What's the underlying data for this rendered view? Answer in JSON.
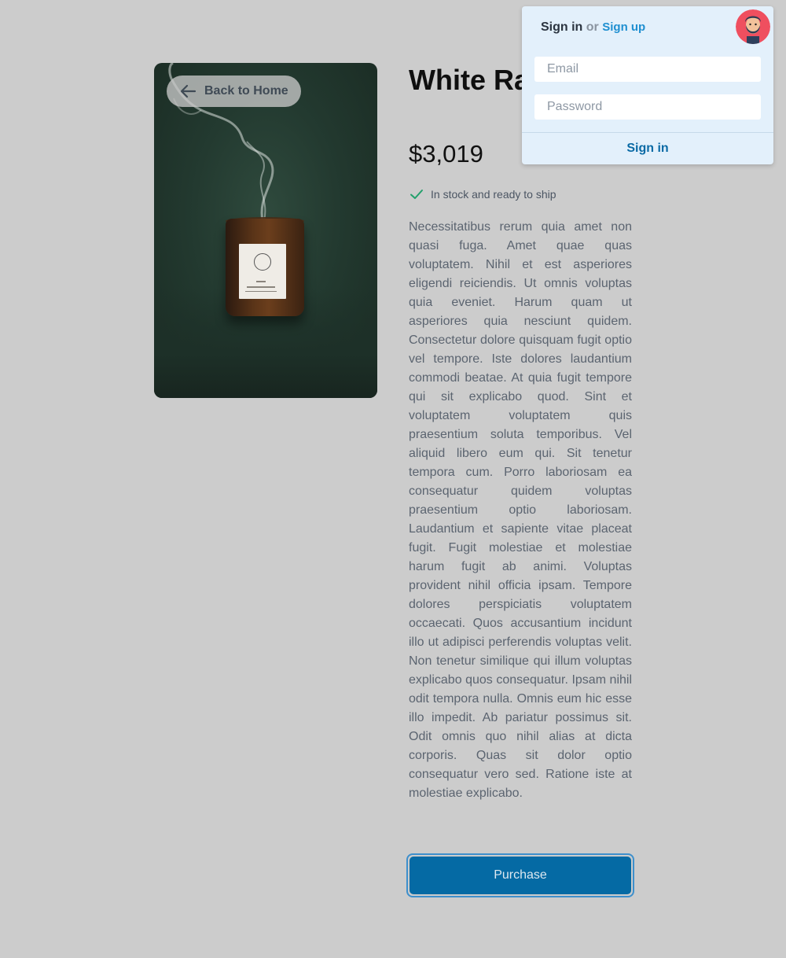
{
  "navigation": {
    "back_label": "Back to Home"
  },
  "product": {
    "title": "White Ra with.",
    "price": "$3,019",
    "stock_status": "In stock and ready to ship",
    "description": "Necessitatibus rerum quia amet non quasi fuga. Amet quae quas voluptatem. Nihil et est asperiores eligendi reiciendis. Ut omnis voluptas quia eveniet. Harum quam ut asperiores quia nesciunt quidem. Consectetur dolore quisquam fugit optio vel tempore. Iste dolores laudantium commodi beatae. At quia fugit tempore qui sit explicabo quod. Sint et voluptatem voluptatem quis praesentium soluta temporibus. Vel aliquid libero eum qui. Sit tenetur tempora cum. Porro laboriosam ea consequatur quidem voluptas praesentium optio laboriosam. Laudantium et sapiente vitae placeat fugit. Fugit molestiae et molestiae harum fugit ab animi. Voluptas provident nihil officia ipsam. Tempore dolores perspiciatis voluptatem occaecati. Quos accusantium incidunt illo ut adipisci perferendis voluptas velit. Non tenetur similique qui illum voluptas explicabo quos consequatur. Ipsam nihil odit tempora nulla. Omnis eum hic esse illo impedit. Ab pariatur possimus sit. Odit omnis quo nihil alias at dicta corporis. Quas sit dolor optio consequatur vero sed. Ratione iste at molestiae explicabo.",
    "purchase_label": "Purchase",
    "image_icon": "candle-product-photo",
    "stock_icon": "check-icon"
  },
  "signin": {
    "title": "Sign in",
    "or_text": "or",
    "signup_link": "Sign up",
    "email_placeholder": "Email",
    "email_value": "",
    "password_placeholder": "Password",
    "password_value": "",
    "submit_label": "Sign in"
  },
  "colors": {
    "background": "#cccccc",
    "primary": "#056aa4",
    "link": "#1f8fd0",
    "stock_check": "#22a06b",
    "panel": "#e3f0fb"
  }
}
